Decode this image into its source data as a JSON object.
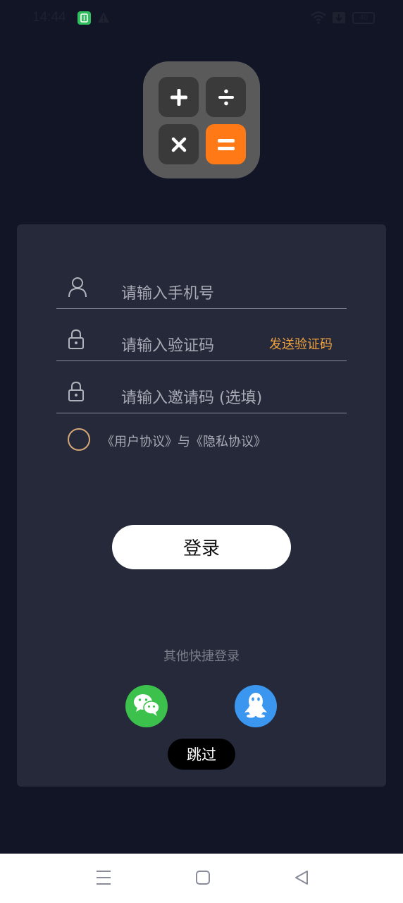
{
  "status_bar": {
    "time": "14:44",
    "battery": "40"
  },
  "login": {
    "phone_placeholder": "请输入手机号",
    "code_placeholder": "请输入验证码",
    "send_code_label": "发送验证码",
    "invite_placeholder": "请输入邀请码 (选填)",
    "agreement_text": "《用户协议》与《隐私协议》",
    "login_button": "登录",
    "other_login_label": "其他快捷登录",
    "skip_button": "跳过"
  },
  "icons": {
    "phone_field": "user-icon",
    "code_field": "lock-icon",
    "invite_field": "lock-icon",
    "wechat": "wechat-icon",
    "qq": "qq-icon",
    "nav_menu": "menu-icon",
    "nav_home": "square-icon",
    "nav_back": "back-triangle-icon"
  },
  "colors": {
    "background": "#121526",
    "card": "#262939",
    "accent_orange": "#ff7a16",
    "send_code": "#f0a23f",
    "wechat_green": "#3bc14c",
    "qq_blue": "#3b96f0"
  }
}
